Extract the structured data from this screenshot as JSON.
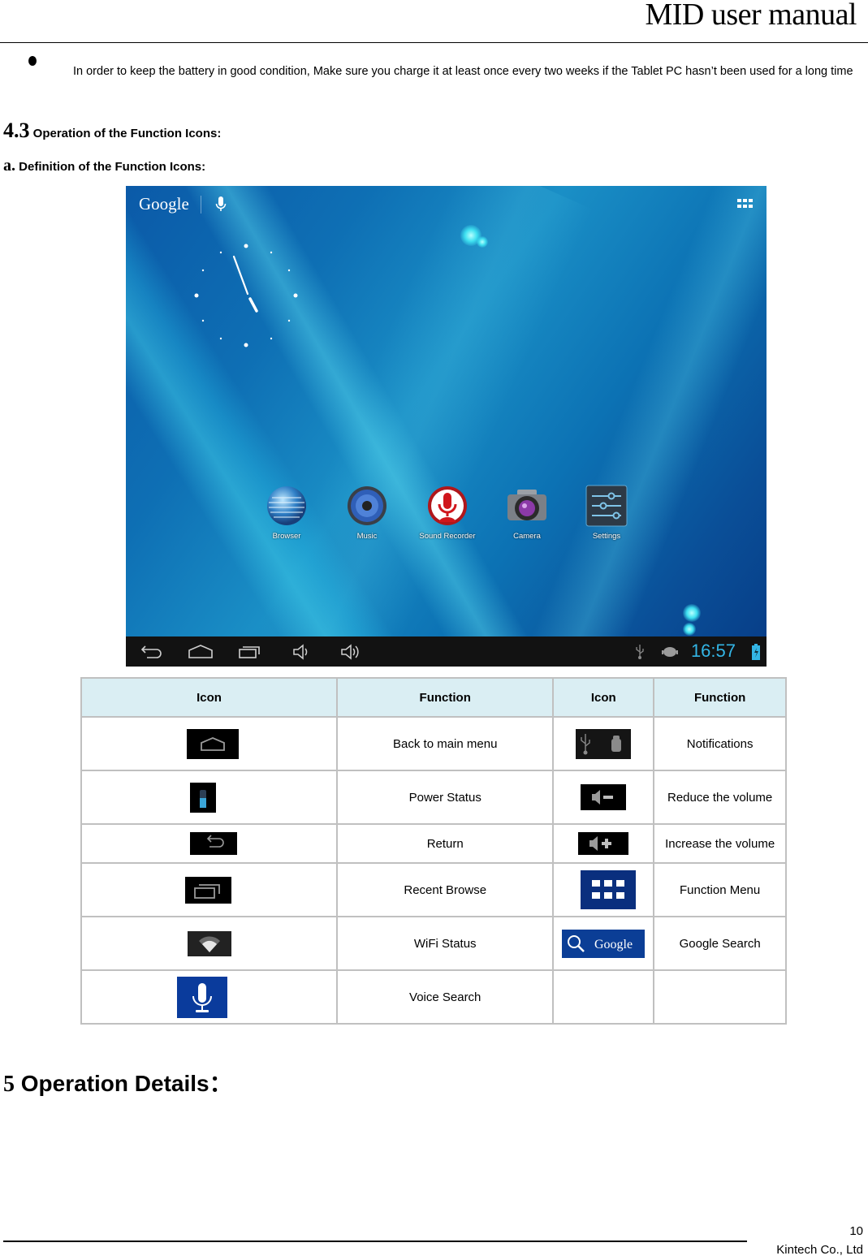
{
  "header": {
    "title": "MID user manual"
  },
  "bullet": {
    "text": "In order to keep the battery in good condition, Make sure you charge it at least once every two weeks if the Tablet PC hasn’t been used for a long time"
  },
  "section_4_3": {
    "number": "4.3",
    "title": "Operation of the Function Icons:"
  },
  "subsection_a": {
    "number": "a.",
    "title": "Definition of the Function Icons:"
  },
  "tablet_screen": {
    "search_logo": "Google",
    "apps": [
      {
        "label": "Browser",
        "icon": "browser-globe-icon"
      },
      {
        "label": "Music",
        "icon": "music-speaker-icon"
      },
      {
        "label": "Sound Recorder",
        "icon": "microphone-icon"
      },
      {
        "label": "Camera",
        "icon": "camera-icon"
      },
      {
        "label": "Settings",
        "icon": "settings-sliders-icon"
      }
    ],
    "navbar": {
      "buttons": [
        "back-icon",
        "home-icon",
        "recent-apps-icon",
        "volume-down-icon",
        "volume-up-icon"
      ],
      "status_icons": [
        "usb-icon",
        "android-debug-icon",
        "battery-charging-icon"
      ],
      "time": "16:57"
    },
    "accent_color": "#33b5e5"
  },
  "icon_table": {
    "headers": [
      "Icon",
      "Function",
      "Icon",
      "Function"
    ],
    "rows": [
      {
        "left_icon": "home-icon",
        "left_function": "Back to main menu",
        "right_icon": "usb-android-notification-icon",
        "right_function": "Notifications"
      },
      {
        "left_icon": "battery-icon",
        "left_function": "Power Status",
        "right_icon": "volume-down-icon",
        "right_function": "Reduce the volume"
      },
      {
        "left_icon": "back-icon",
        "left_function": "Return",
        "right_icon": "volume-up-icon",
        "right_function": "Increase the volume"
      },
      {
        "left_icon": "recent-apps-icon",
        "left_function": "Recent Browse",
        "right_icon": "apps-grid-icon",
        "right_function": "Function Menu"
      },
      {
        "left_icon": "wifi-icon",
        "left_function": "WiFi Status",
        "right_icon": "google-search-icon",
        "right_function": "Google Search"
      },
      {
        "left_icon": "voice-search-mic-icon",
        "left_function": "Voice Search",
        "right_icon": "",
        "right_function": ""
      }
    ],
    "google_search_icon_text": "Google"
  },
  "section_5": {
    "number": "5",
    "title": "Operation Details："
  },
  "footer": {
    "page_number": "10",
    "company": "Kintech Co., Ltd"
  }
}
